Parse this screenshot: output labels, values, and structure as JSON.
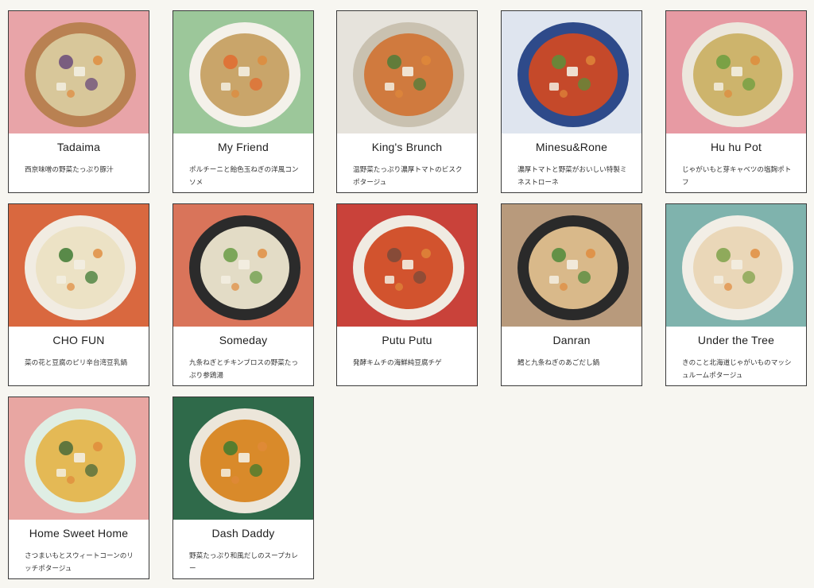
{
  "products": [
    {
      "name": "Tadaima",
      "description": "西京味噌の野菜たっぷり豚汁",
      "bg": "#e8a4a8",
      "bowl": "#b98152",
      "soup": "#d8c79a",
      "accent": "#6a4a7a"
    },
    {
      "name": "My Friend",
      "description": "ポルチーニと飴色玉ねぎの洋風コンソメ",
      "bg": "#9cc79a",
      "bowl": "#f4f1ea",
      "soup": "#c9a56a",
      "accent": "#e26b2f"
    },
    {
      "name": "King's Brunch",
      "description": "温野菜たっぷり濃厚トマトのビスクポタージュ",
      "bg": "#e6e3dc",
      "bowl": "#c9c1b0",
      "soup": "#d07a3e",
      "accent": "#4f7d3a"
    },
    {
      "name": "Minesu&Rone",
      "description": "濃厚トマトと野菜がおいしい特製ミネストローネ",
      "bg": "#dfe5ef",
      "bowl": "#2e4a8a",
      "soup": "#c5492a",
      "accent": "#5a8f3b"
    },
    {
      "name": "Hu hu Pot",
      "description": "じゃがいもと芽キャベツの塩麹ポトフ",
      "bg": "#e79aa3",
      "bowl": "#ece7dd",
      "soup": "#cdb46c",
      "accent": "#6b9d3e"
    },
    {
      "name": "CHO FUN",
      "description": "菜の花と豆腐のピリ辛台湾豆乳鍋",
      "bg": "#d9683f",
      "bowl": "#f1ece2",
      "soup": "#ece2c5",
      "accent": "#3f7a33"
    },
    {
      "name": "Someday",
      "description": "九条ねぎとチキンブロスの野菜たっぷり参鶏湯",
      "bg": "#d9745a",
      "bowl": "#2b2b2b",
      "soup": "#e3dcc6",
      "accent": "#6a9c45"
    },
    {
      "name": "Putu Putu",
      "description": "発酵キムチの海鮮純豆腐チゲ",
      "bg": "#c9423a",
      "bowl": "#f0ebe2",
      "soup": "#d2532e",
      "accent": "#7a4a3a"
    },
    {
      "name": "Danran",
      "description": "鱈と九条ねぎのあごだし鍋",
      "bg": "#b89a7c",
      "bowl": "#2a2a2a",
      "soup": "#d9b98a",
      "accent": "#4f8a3a"
    },
    {
      "name": "Under the Tree",
      "description": "きのこと北海道じゃがいものマッシュルームポタージュ",
      "bg": "#7fb3ad",
      "bowl": "#f2eee6",
      "soup": "#ead7b8",
      "accent": "#7fa24a"
    },
    {
      "name": "Home Sweet Home",
      "description": "さつまいもとスウィートコーンのリッチポタージュ",
      "bg": "#e8a6a2",
      "bowl": "#dfeee4",
      "soup": "#e4b955",
      "accent": "#4a6a3a"
    },
    {
      "name": "Dash Daddy",
      "description": "野菜たっぷり和風だしのスープカレー",
      "bg": "#2f6a4a",
      "bowl": "#ece6da",
      "soup": "#d98a2a",
      "accent": "#3f7a2f"
    }
  ]
}
